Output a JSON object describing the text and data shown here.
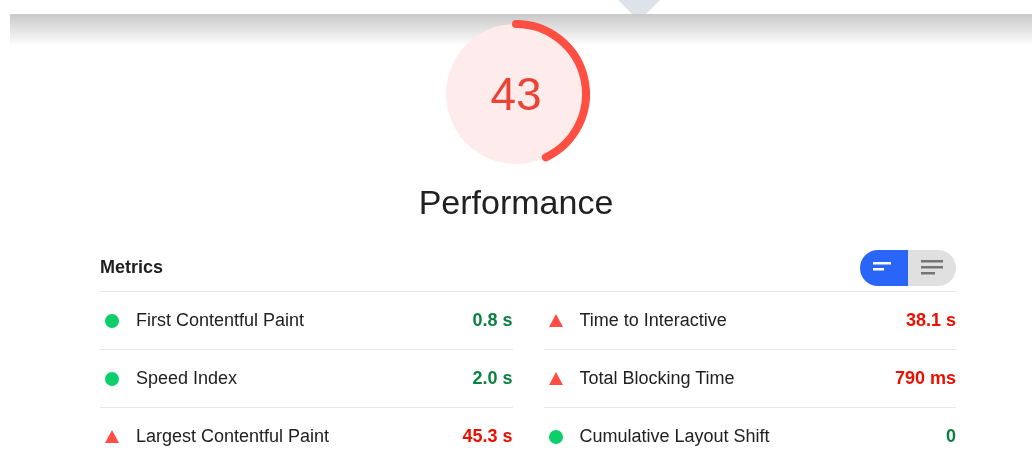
{
  "gauge": {
    "score": "43",
    "level": 0.43,
    "kind": "fail"
  },
  "category_title": "Performance",
  "metrics_title": "Metrics",
  "view_toggle": [
    {
      "selected": true
    },
    {
      "selected": false
    }
  ],
  "metrics": [
    {
      "label": "First Contentful Paint",
      "value": "0.8 s",
      "kind": "pass"
    },
    {
      "label": "Time to Interactive",
      "value": "38.1 s",
      "kind": "fail"
    },
    {
      "label": "Speed Index",
      "value": "2.0 s",
      "kind": "pass"
    },
    {
      "label": "Total Blocking Time",
      "value": "790 ms",
      "kind": "fail"
    },
    {
      "label": "Largest Contentful Paint",
      "value": "45.3 s",
      "kind": "fail"
    },
    {
      "label": "Cumulative Layout Shift",
      "value": "0",
      "kind": "pass"
    }
  ]
}
